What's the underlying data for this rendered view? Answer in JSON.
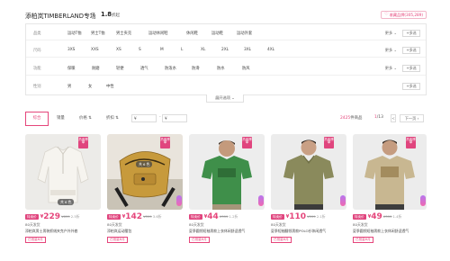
{
  "header": {
    "store_name": "添柏岚TIMBERLAND专场",
    "score": "1.8",
    "score_unit": "折起",
    "fav_label": "收藏品牌(305,289)"
  },
  "filters": {
    "rows": [
      {
        "label": "品类",
        "options": [
          "运动T恤",
          "男士T恤",
          "男士夹克",
          "运动休闲鞋",
          "休闲鞋",
          "运动鞋",
          "运动外套"
        ],
        "more": "更多",
        "multi": "多选"
      },
      {
        "label": "尺码",
        "options": [
          "3XS",
          "XXS",
          "XS",
          "S",
          "M",
          "L",
          "XL",
          "2XL",
          "3XL",
          "4XL"
        ],
        "more": "更多",
        "multi": "多选"
      },
      {
        "label": "功能",
        "options": [
          "保暖",
          "耐磨",
          "轻便",
          "透气",
          "防泼水",
          "防滑",
          "防水",
          "防风"
        ],
        "more": "更多",
        "multi": "多选"
      },
      {
        "label": "性别",
        "options": [
          "男",
          "女",
          "中性"
        ],
        "more": "",
        "multi": "多选"
      }
    ],
    "expand_label": "展开选项"
  },
  "sortbar": {
    "default": "综合",
    "sales": "销量",
    "price": "价格",
    "discount": "折扣",
    "price_min": "¥",
    "price_max": "¥",
    "count_prefix": "2425",
    "count_suffix": "件商品",
    "page_current": "1",
    "page_total": "/13",
    "prev": "<",
    "next": "下一页"
  },
  "products": [
    {
      "rank": "热卖榜单",
      "count": "共 6 色",
      "sale_tag": "特卖价",
      "price": "229",
      "orig": "¥699",
      "disc": "2.5折",
      "tag1": "80天发货",
      "title": "添柏岚男士男装抓绒夹克户外外套",
      "tag3": "已抢量8月",
      "image": "white-fleece"
    },
    {
      "rank": "热卖榜单",
      "count": "共 6 色",
      "sale_tag": "特卖价",
      "price": "142",
      "orig": "¥399",
      "disc": "3.6折",
      "tag1": "80天发货",
      "title": "添柏岚运动腰包",
      "tag3": "已抢量8月",
      "image": "yellow-bag"
    },
    {
      "rank": "热卖榜单",
      "count": "",
      "sale_tag": "特卖价",
      "price": "44",
      "orig": "¥399",
      "disc": "1.2折",
      "tag1": "80天发货",
      "title": "夏季圆领短袖男款上衣休闲舒适透气",
      "tag3": "已抢量8月",
      "image": "green-tee"
    },
    {
      "rank": "热卖榜单",
      "count": "",
      "sale_tag": "特卖价",
      "price": "110",
      "orig": "¥599",
      "disc": "2.1折",
      "tag1": "80天发货",
      "title": "夏季短袖翻领男款POLO衫休闲透气",
      "tag3": "已抢量8月",
      "image": "olive-polo"
    },
    {
      "rank": "热卖榜单",
      "count": "",
      "sale_tag": "特卖价",
      "price": "49",
      "orig": "¥399",
      "disc": "1.4折",
      "tag1": "80天发货",
      "title": "夏季圆领短袖男款上衣休闲舒适透气",
      "tag3": "已抢量8月",
      "image": "khaki-tee"
    }
  ],
  "colors": {
    "accent": "#e5457b"
  }
}
